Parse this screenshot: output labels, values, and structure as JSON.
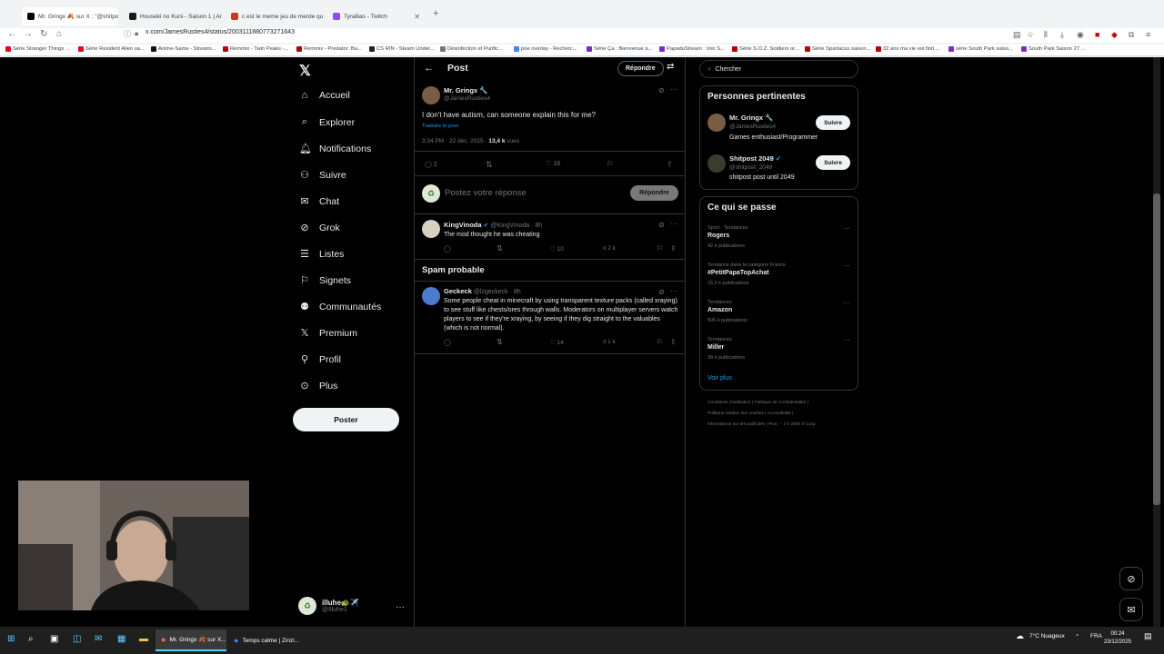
{
  "browser": {
    "tabs": [
      {
        "title": "Mr. Gringx 🍂 sur X : \"@shitpos",
        "active": true,
        "color": "#000000"
      },
      {
        "title": "Houseki no Kuni - Saison 1 | Ar",
        "active": false,
        "color": "#1a1a1a"
      },
      {
        "title": "c est le meme jeu de merde qu",
        "active": false,
        "color": "#d93025"
      },
      {
        "title": "Tyrallias - Twitch",
        "active": false,
        "color": "#9146ff"
      }
    ],
    "url": "x.com/JamesRusties4/status/2003111880773271643",
    "bookmarks": [
      "Série Stranger Things ...",
      "Série Resident Alien sa...",
      "Anime-Sama - Streami...",
      "Remmix - Twin Peaks -...",
      "Remmix - Predator: Ba...",
      "CS RIN - Steam Under...",
      "Désinfection et Purific...",
      "poe overlay - Recherc...",
      "Série Ça : Bienvenue à...",
      "PapaduStream : Voir S...",
      "Série S.O.Z. Soldiers or...",
      "Série Spartacus saison...",
      "32 ans ma vie est finit ...",
      "série South Park saiso...",
      "South Park Saison 27 ..."
    ]
  },
  "sidebar": {
    "items": [
      {
        "label": "Accueil",
        "icon": "home-icon",
        "glyph": "⌂"
      },
      {
        "label": "Explorer",
        "icon": "search-icon",
        "glyph": "⌕"
      },
      {
        "label": "Notifications",
        "icon": "bell-icon",
        "glyph": "🔔︎"
      },
      {
        "label": "Suivre",
        "icon": "follow-icon",
        "glyph": "⚇"
      },
      {
        "label": "Chat",
        "icon": "mail-icon",
        "glyph": "✉"
      },
      {
        "label": "Grok",
        "icon": "grok-icon",
        "glyph": "⊘"
      },
      {
        "label": "Listes",
        "icon": "list-icon",
        "glyph": "☰"
      },
      {
        "label": "Signets",
        "icon": "bookmark-icon",
        "glyph": "⚐"
      },
      {
        "label": "Communautés",
        "icon": "communities-icon",
        "glyph": "⚉"
      },
      {
        "label": "Premium",
        "icon": "x-icon",
        "glyph": "𝕏"
      },
      {
        "label": "Profil",
        "icon": "person-icon",
        "glyph": "⚲"
      },
      {
        "label": "Plus",
        "icon": "more-icon",
        "glyph": "⊙"
      }
    ],
    "post_label": "Poster",
    "account": {
      "name": "illuhe🐢✈️",
      "handle": "@Illuhe1"
    }
  },
  "main": {
    "header_title": "Post",
    "reply_button": "Répondre",
    "tweet": {
      "name": "Mr. Gringx 🔧",
      "handle": "@JamesRusties4",
      "text": "I don't have autism, can someone explain this for me?",
      "translate": "Traduire le post",
      "time": "3:34 PM · 22 déc. 2025 ·",
      "views_count": "13,4 k",
      "views_label": "vues",
      "replies": "2",
      "likes": "18"
    },
    "compose_placeholder": "Postez votre réponse",
    "compose_button": "Répondre",
    "reply1": {
      "name": "KingVinoda",
      "handle": "@KingVinoda · 8h",
      "text": "The mod thought he was cheating",
      "likes": "10",
      "views": "2 k"
    },
    "spam_heading": "Spam probable",
    "reply2": {
      "name": "Geckeck",
      "handle": "@lzgeckeck · 8h",
      "text": "Some people cheat in minecraft by using transparent texture packs (called xraying) to see stuff like chests/ores through walls. Moderators on multiplayer servers watch players to see if they're xraying, by seeing if they dig straight to the valuables (which is not normal).",
      "likes": "14",
      "views": "1 k"
    }
  },
  "right": {
    "search_placeholder": "Chercher",
    "relevant_title": "Personnes pertinentes",
    "people": [
      {
        "name": "Mr. Gringx 🔧",
        "handle": "@JamesRusties4",
        "bio": "Games enthusiast/Programmer",
        "follow": "Suivre"
      },
      {
        "name": "Shitpost 2049",
        "handle": "@shitpost_2049",
        "bio": "shitpost post until 2049",
        "follow": "Suivre"
      }
    ],
    "happening_title": "Ce qui se passe",
    "trends": [
      {
        "context": "Sport · Tendances",
        "name": "Rogers",
        "count": "42 k publications"
      },
      {
        "context": "Tendance dans la catégorie France",
        "name": "#PetitPapaTopAchat",
        "count": "15,5 k publications"
      },
      {
        "context": "Tendances",
        "name": "Amazon",
        "count": "505 k publications"
      },
      {
        "context": "Tendances",
        "name": "Miller",
        "count": "38 k publications"
      }
    ],
    "show_more": "Voir plus",
    "footer": [
      "Conditions d'utilisation | Politique de Confidentialité |",
      "Politique relative aux cookies | Accessibilité |",
      "Informations sur les publicités | Plus ··· | © 2025 X Corp."
    ]
  },
  "taskbar": {
    "apps": [
      {
        "label": "Mr. Gringx 🍂 sur X...",
        "active": true
      },
      {
        "label": "Temps calme | Zinzi...",
        "active": false
      }
    ],
    "weather": "7°C  Nuageux",
    "lang": "FRA",
    "time": "00:24",
    "date": "23/12/2025"
  }
}
